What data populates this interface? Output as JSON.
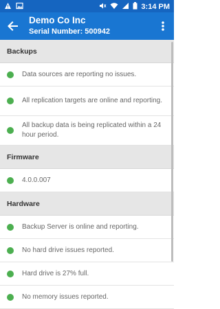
{
  "status_bar": {
    "time": "3:14 PM",
    "left_icons": [
      "warning-icon",
      "image-icon"
    ],
    "right_icons": [
      "mute-icon",
      "wifi-icon",
      "signal-icon",
      "battery-icon"
    ]
  },
  "app_bar": {
    "title": "Demo Co Inc",
    "subtitle": "Serial Number: 500942",
    "color": "#1976d2",
    "status_color": "#1565c0"
  },
  "sections": [
    {
      "title": "Backups",
      "items": [
        "Data sources are reporting no issues.",
        "All replication targets are online and reporting.",
        "All backup data is being replicated within a 24 hour period."
      ]
    },
    {
      "title": "Firmware",
      "items": [
        "4.0.0.007"
      ]
    },
    {
      "title": "Hardware",
      "items": [
        "Backup Server is online and reporting.",
        "No hard drive issues reported.",
        "Hard drive is 27% full.",
        "No memory issues reported."
      ]
    }
  ],
  "status_dot_color": "#4caf50"
}
